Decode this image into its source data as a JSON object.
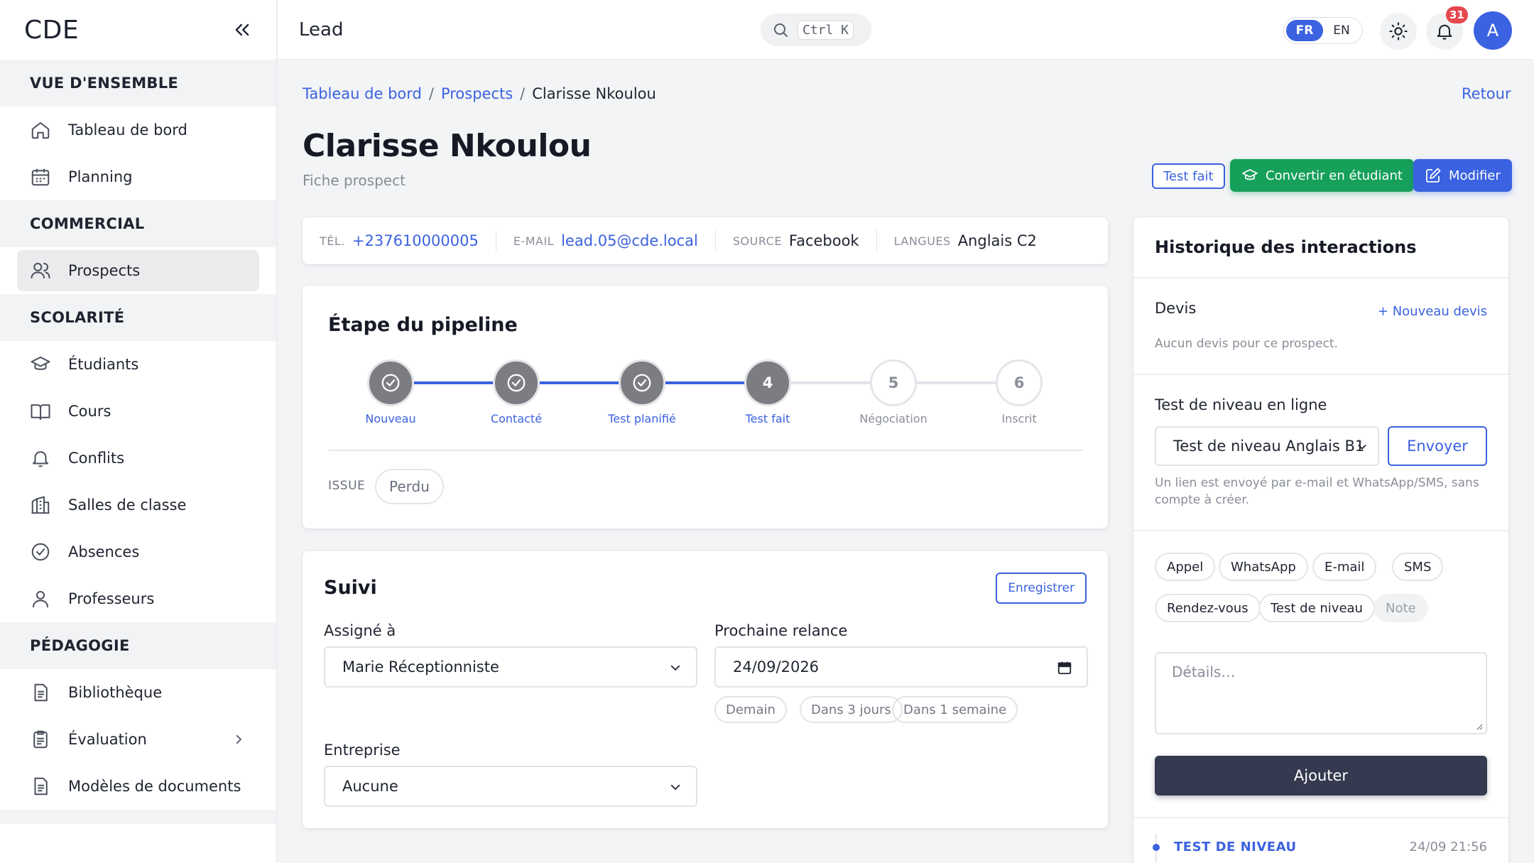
{
  "app": {
    "logo": "CDE"
  },
  "sidebar": {
    "sections": [
      {
        "title": "VUE D'ENSEMBLE",
        "items": [
          {
            "label": "Tableau de bord",
            "icon": "home-icon"
          },
          {
            "label": "Planning",
            "icon": "calendar-icon"
          }
        ]
      },
      {
        "title": "COMMERCIAL",
        "items": [
          {
            "label": "Prospects",
            "icon": "users-icon",
            "active": true
          }
        ]
      },
      {
        "title": "SCOLARITÉ",
        "items": [
          {
            "label": "Étudiants",
            "icon": "graduation-cap-icon"
          },
          {
            "label": "Cours",
            "icon": "book-icon"
          },
          {
            "label": "Conflits",
            "icon": "bell-icon"
          },
          {
            "label": "Salles de classe",
            "icon": "building-icon"
          },
          {
            "label": "Absences",
            "icon": "check-circle-icon"
          },
          {
            "label": "Professeurs",
            "icon": "user-icon"
          }
        ]
      },
      {
        "title": "PÉDAGOGIE",
        "items": [
          {
            "label": "Bibliothèque",
            "icon": "document-icon"
          },
          {
            "label": "Évaluation",
            "icon": "clipboard-icon",
            "has_submenu": true
          },
          {
            "label": "Modèles de documents",
            "icon": "document-icon"
          }
        ]
      }
    ]
  },
  "topbar": {
    "title": "Lead",
    "search_shortcut": "Ctrl K",
    "lang_fr": "FR",
    "lang_en": "EN",
    "notifications_count": "31",
    "avatar_initial": "A"
  },
  "breadcrumb": {
    "home": "Tableau de bord",
    "section": "Prospects",
    "current": "Clarisse Nkoulou"
  },
  "back_label": "Retour",
  "page": {
    "title": "Clarisse Nkoulou",
    "subtitle": "Fiche prospect"
  },
  "actions": {
    "test_done": "Test fait",
    "convert": "Convertir en étudiant",
    "edit": "Modifier"
  },
  "contact": {
    "phone_label": "TÉL.",
    "phone": "+237610000005",
    "email_label": "E-MAIL",
    "email": "lead.05@cde.local",
    "source_label": "SOURCE",
    "source": "Facebook",
    "languages_label": "LANGUES",
    "languages": "Anglais C2"
  },
  "pipeline": {
    "title": "Étape du pipeline",
    "steps": [
      {
        "num": "1",
        "label": "Nouveau",
        "state": "done"
      },
      {
        "num": "2",
        "label": "Contacté",
        "state": "done"
      },
      {
        "num": "3",
        "label": "Test planifié",
        "state": "done"
      },
      {
        "num": "4",
        "label": "Test fait",
        "state": "current"
      },
      {
        "num": "5",
        "label": "Négociation",
        "state": "todo"
      },
      {
        "num": "6",
        "label": "Inscrit",
        "state": "todo"
      }
    ],
    "issue_label": "ISSUE",
    "issue_value": "Perdu"
  },
  "suivi": {
    "title": "Suivi",
    "save_label": "Enregistrer",
    "assigned_label": "Assigné à",
    "assigned_value": "Marie Réceptionniste",
    "next_label": "Prochaine relance",
    "next_value": "24/09/2026",
    "quick_dates": [
      "Demain",
      "Dans 3 jours",
      "Dans 1 semaine"
    ],
    "company_label": "Entreprise",
    "company_value": "Aucune"
  },
  "history": {
    "title": "Historique des interactions",
    "devis_label": "Devis",
    "new_devis": "+ Nouveau devis",
    "no_devis": "Aucun devis pour ce prospect.",
    "online_test_label": "Test de niveau en ligne",
    "test_selected": "Test de niveau Anglais B1",
    "send_label": "Envoyer",
    "send_note": "Un lien est envoyé par e-mail et WhatsApp/SMS, sans compte à créer.",
    "types": [
      "Appel",
      "WhatsApp",
      "E-mail",
      "SMS",
      "Rendez-vous",
      "Test de niveau",
      "Note"
    ],
    "details_placeholder": "Détails…",
    "add_label": "Ajouter",
    "timeline": [
      {
        "type": "TEST DE NIVEAU",
        "time": "24/09 21:56"
      }
    ]
  },
  "colors": {
    "accent": "#3b62e0",
    "success": "#16a05a",
    "dark_button": "#353a50",
    "danger_badge": "#e5484d"
  }
}
